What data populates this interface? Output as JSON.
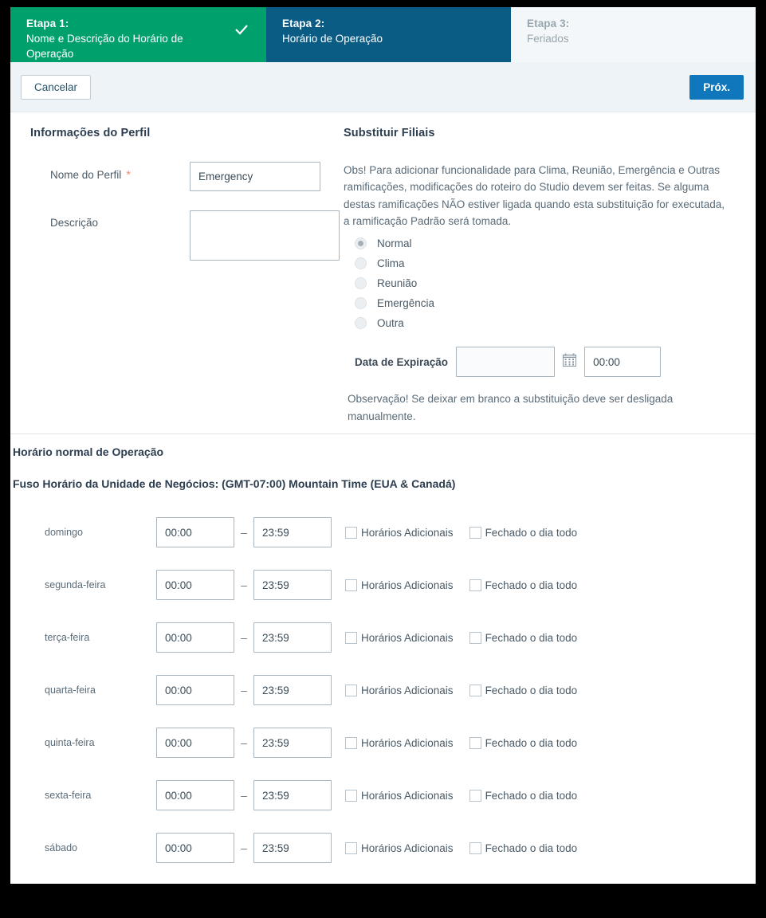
{
  "steps": [
    {
      "num": "Etapa 1:",
      "label": "Nome e Descrição do Horário de Operação",
      "state": "done",
      "icon": "check-icon"
    },
    {
      "num": "Etapa 2:",
      "label": "Horário de Operação",
      "state": "current"
    },
    {
      "num": "Etapa 3:",
      "label": "Feriados",
      "state": "todo"
    }
  ],
  "toolbar": {
    "cancel_label": "Cancelar",
    "next_label": "Próx."
  },
  "profile": {
    "section_title": "Informações do Perfil",
    "name_label": "Nome do Perfil",
    "required_mark": "*",
    "name_value": "Emergency",
    "description_label": "Descrição",
    "description_value": ""
  },
  "override": {
    "section_title": "Substituir Filiais",
    "note": "Obs! Para adicionar funcionalidade para Clima, Reunião, Emergência e Outras ramificações, modificações do roteiro do Studio devem ser feitas. Se alguma destas ramificações NÃO estiver ligada quando esta substituição for executada, a ramificação Padrão será tomada.",
    "options": [
      {
        "label": "Normal",
        "selected": true
      },
      {
        "label": "Clima",
        "selected": false
      },
      {
        "label": "Reunião",
        "selected": false
      },
      {
        "label": "Emergência",
        "selected": false
      },
      {
        "label": "Outra",
        "selected": false
      }
    ],
    "expiration_label": "Data de Expiração",
    "expiration_date_value": "",
    "calendar_icon": "calendar-icon",
    "expiration_time_value": "00:00",
    "observation": "Observação! Se deixar em branco a substituição deve ser desligada manualmente."
  },
  "schedule": {
    "title": "Horário normal de Operação",
    "timezone": "Fuso Horário da Unidade de Negócios: (GMT-07:00) Mountain Time (EUA & Canadá)",
    "dash": "–",
    "additional_hours_label": "Horários Adicionais",
    "closed_all_day_label": "Fechado o dia todo",
    "days": [
      {
        "name": "domingo",
        "start": "00:00",
        "end": "23:59",
        "additional": false,
        "closed": false
      },
      {
        "name": "segunda-feira",
        "start": "00:00",
        "end": "23:59",
        "additional": false,
        "closed": false
      },
      {
        "name": "terça-feira",
        "start": "00:00",
        "end": "23:59",
        "additional": false,
        "closed": false
      },
      {
        "name": "quarta-feira",
        "start": "00:00",
        "end": "23:59",
        "additional": false,
        "closed": false
      },
      {
        "name": "quinta-feira",
        "start": "00:00",
        "end": "23:59",
        "additional": false,
        "closed": false
      },
      {
        "name": "sexta-feira",
        "start": "00:00",
        "end": "23:59",
        "additional": false,
        "closed": false
      },
      {
        "name": "sábado",
        "start": "00:00",
        "end": "23:59",
        "additional": false,
        "closed": false
      }
    ]
  },
  "colors": {
    "step_done": "#00a06c",
    "step_current": "#0b5c84",
    "step_todo_bg": "#f3f7f9",
    "primary_button": "#1077bc",
    "toolbar_bg": "#eef3f7",
    "required": "#e8927c"
  }
}
